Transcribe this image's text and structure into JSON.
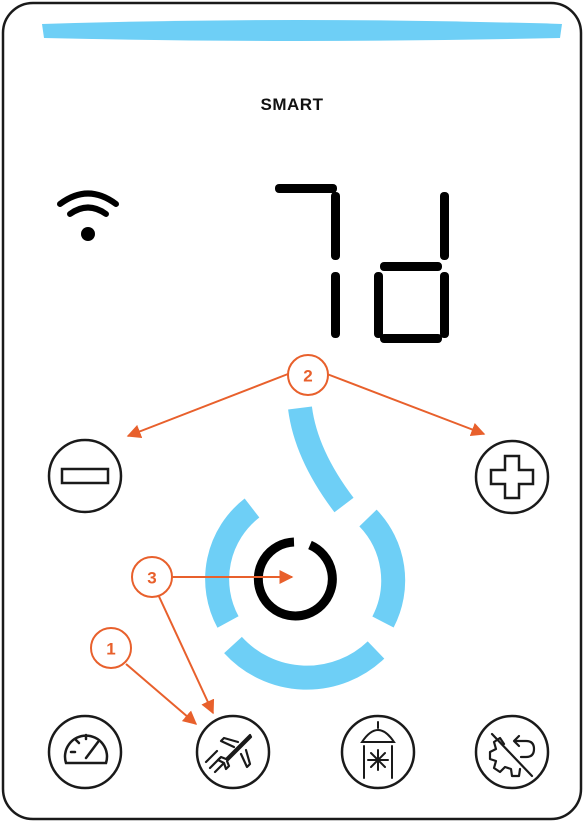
{
  "panel": {
    "brand_label": "SMART",
    "display_value": "7d",
    "indicator_color": "#6ecff6",
    "callout_color": "#e8602c"
  },
  "icons": {
    "wifi": "wifi-icon",
    "minus": "minus-icon",
    "plus": "plus-icon",
    "power_ring": "power-ring-icon",
    "speedometer": "speedometer-icon",
    "vacation": "airplane-icon",
    "cold_shower": "shower-snowflake-icon",
    "reset": "gear-undo-icon"
  },
  "callouts": {
    "c1": "1",
    "c2": "2",
    "c3": "3"
  }
}
